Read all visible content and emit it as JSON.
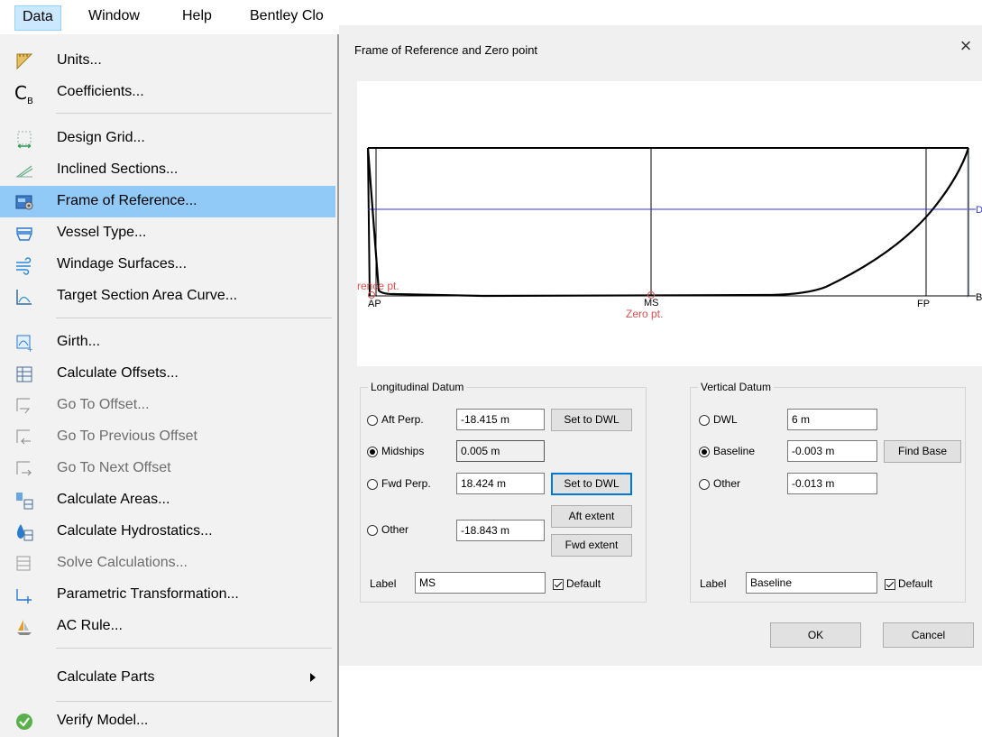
{
  "menubar": {
    "items": [
      "Data",
      "Window",
      "Help",
      "Bentley Clo"
    ]
  },
  "menu": {
    "units": "Units...",
    "coefficients": "Coefficients...",
    "coefficients_icon": "C",
    "coefficients_icon_sub": "B",
    "design_grid": "Design Grid...",
    "inclined_sections": "Inclined Sections...",
    "frame_of_reference": "Frame of Reference...",
    "vessel_type": "Vessel Type...",
    "windage_surfaces": "Windage Surfaces...",
    "target_section": "Target Section Area Curve...",
    "girth": "Girth...",
    "calc_offsets": "Calculate Offsets...",
    "goto_offset": "Go To Offset...",
    "goto_prev_offset": "Go To Previous Offset",
    "goto_next_offset": "Go To Next Offset",
    "calc_areas": "Calculate Areas...",
    "calc_hydrostatics": "Calculate Hydrostatics...",
    "solve_calcs": "Solve Calculations...",
    "parametric": "Parametric Transformation...",
    "ac_rule": "AC Rule...",
    "calc_parts": "Calculate Parts",
    "verify_model": "Verify Model..."
  },
  "dialog": {
    "title": "Frame of Reference and Zero point",
    "close": "×",
    "preview": {
      "ap": "AP",
      "ms": "MS",
      "fp": "FP",
      "zero_pt": "Zero pt.",
      "ref_pt": "rence pt.",
      "dwl_mark": "D",
      "base_mark": "B"
    },
    "longitudinal": {
      "legend": "Longitudinal Datum",
      "aft_perp_label": "Aft Perp.",
      "aft_perp_value": "-18.415 m",
      "midships_label": "Midships",
      "midships_value": "0.005 m",
      "fwd_perp_label": "Fwd Perp.",
      "fwd_perp_value": "18.424 m",
      "other_label": "Other",
      "other_value": "-18.843 m",
      "set_to_dwl": "Set to DWL",
      "aft_extent": "Aft extent",
      "fwd_extent": "Fwd extent",
      "label_label": "Label",
      "label_value": "MS",
      "default_label": "Default"
    },
    "vertical": {
      "legend": "Vertical Datum",
      "dwl_label": "DWL",
      "dwl_value": "6 m",
      "baseline_label": "Baseline",
      "baseline_value": "-0.003 m",
      "other_label": "Other",
      "other_value": "-0.013 m",
      "find_base": "Find Base",
      "label_label": "Label",
      "label_value": "Baseline",
      "default_label": "Default"
    },
    "ok": "OK",
    "cancel": "Cancel"
  },
  "colors": {
    "menu_highlight": "#91c9f7",
    "dwl_line": "#3a3ad6",
    "marker_red": "#e05050",
    "focus_border": "#0078d7"
  }
}
